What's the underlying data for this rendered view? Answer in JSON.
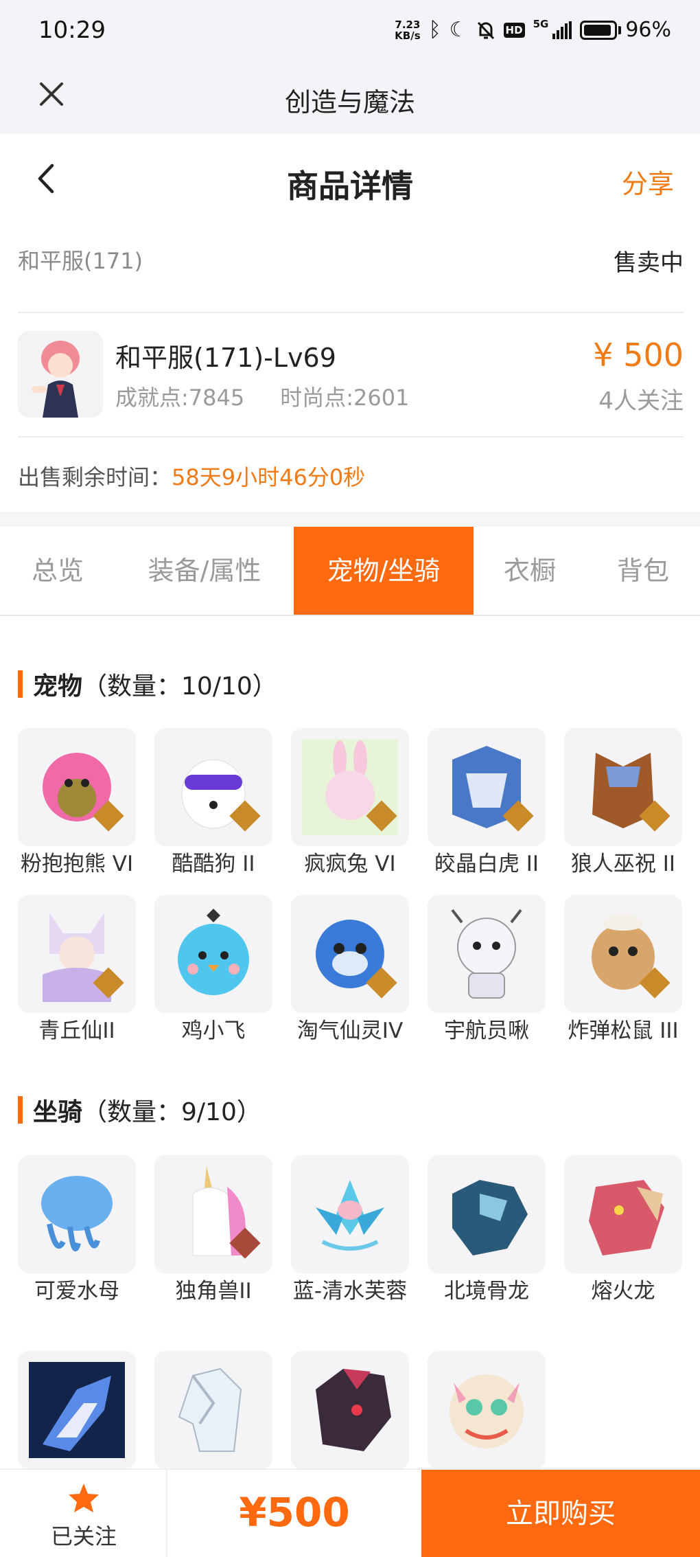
{
  "status_bar": {
    "time": "10:29",
    "net_speed_value": "7.23",
    "net_speed_unit": "KB/s",
    "network": "5G",
    "battery": "96%"
  },
  "webview": {
    "title": "创造与魔法"
  },
  "header": {
    "title": "商品详情",
    "share_label": "分享"
  },
  "product": {
    "server": "和平服(171)",
    "status": "售卖中",
    "name": "和平服(171)-Lv69",
    "achievement": "成就点:7845",
    "fashion": "时尚点:2601",
    "price": "¥ 500",
    "followers": "4人关注",
    "remaining_label": "出售剩余时间：",
    "remaining_value": "58天9小时46分0秒"
  },
  "tabs": [
    {
      "label": "总览"
    },
    {
      "label": "装备/属性"
    },
    {
      "label": "宠物/坐骑"
    },
    {
      "label": "衣橱"
    },
    {
      "label": "背包"
    }
  ],
  "active_tab": "宠物/坐骑",
  "pets": {
    "title": "宠物",
    "count": "（数量：10/10）",
    "items": [
      {
        "label": "粉抱抱熊 VI"
      },
      {
        "label": "酷酷狗 II"
      },
      {
        "label": "疯疯兔 VI"
      },
      {
        "label": "皎晶白虎 II"
      },
      {
        "label": "狼人巫祝 II"
      },
      {
        "label": "青丘仙II"
      },
      {
        "label": "鸡小飞"
      },
      {
        "label": "淘气仙灵IV"
      },
      {
        "label": "宇航员啾"
      },
      {
        "label": "炸弹松鼠 III"
      }
    ]
  },
  "mounts": {
    "title": "坐骑",
    "count": "（数量：9/10）",
    "items": [
      {
        "label": "可爱水母"
      },
      {
        "label": "独角兽II"
      },
      {
        "label": "蓝-清水芙蓉"
      },
      {
        "label": "北境骨龙"
      },
      {
        "label": "熔火龙"
      },
      {
        "label": ""
      },
      {
        "label": ""
      },
      {
        "label": ""
      },
      {
        "label": ""
      }
    ]
  },
  "bottom_bar": {
    "follow_label": "已关注",
    "price": "¥500",
    "buy_label": "立即购买"
  },
  "colors": {
    "accent": "#ff6a10",
    "price": "#f07a14",
    "topbar": "#f2f4f7"
  }
}
